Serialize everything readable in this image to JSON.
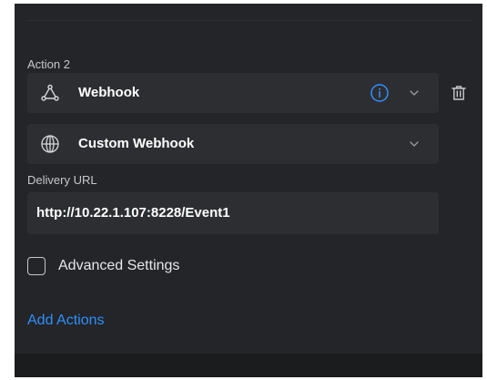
{
  "action": {
    "label": "Action 2",
    "type_select": {
      "value": "Webhook",
      "icon": "webhook-icon"
    },
    "webhook_select": {
      "value": "Custom Webhook",
      "icon": "globe-icon"
    },
    "delivery_url": {
      "label": "Delivery URL",
      "value": "http://10.22.1.107:8228/Event1"
    },
    "advanced_settings": {
      "label": "Advanced Settings",
      "checked": false
    }
  },
  "add_actions_label": "Add Actions",
  "colors": {
    "panel": "#242528",
    "field": "#2d2e32",
    "accent": "#2f8ffe",
    "text": "#ffffff",
    "muted": "#c6c8cc"
  }
}
